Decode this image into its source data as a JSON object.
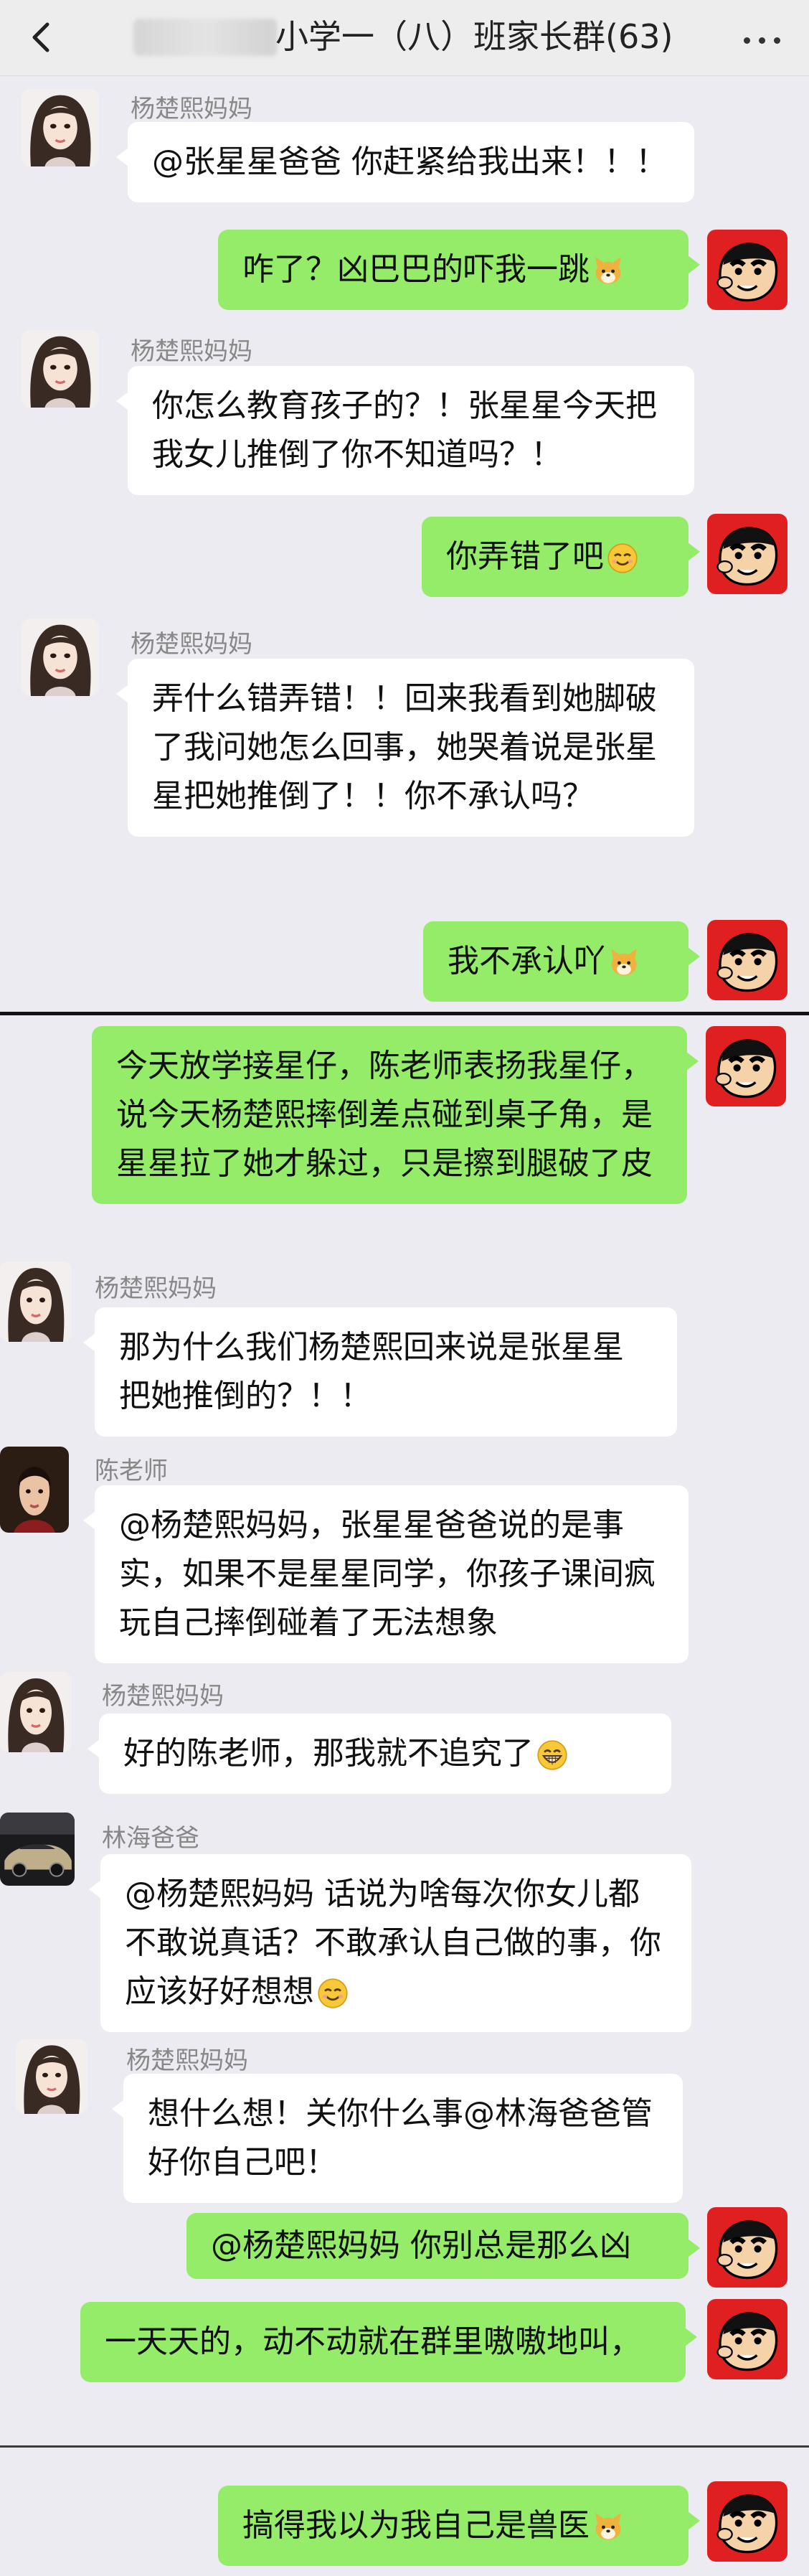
{
  "header": {
    "title": "小学一（八）班家长群(63)"
  },
  "messages": [
    {
      "sender": "杨楚熙妈妈",
      "text": "@张星星爸爸 你赶紧给我出来！！！"
    },
    {
      "sender": "me",
      "text": "咋了？凶巴巴的吓我一跳",
      "emoji": "dog-emoji"
    },
    {
      "sender": "杨楚熙妈妈",
      "text": "你怎么教育孩子的？！张星星今天把我女儿推倒了你不知道吗？！"
    },
    {
      "sender": "me",
      "text": "你弄错了吧",
      "emoji": "smile-emoji"
    },
    {
      "sender": "杨楚熙妈妈",
      "text": "弄什么错弄错！！回来我看到她脚破了我问她怎么回事，她哭着说是张星星把她推倒了！！你不承认吗？"
    },
    {
      "sender": "me",
      "text": "我不承认吖",
      "emoji": "dog-emoji"
    },
    {
      "sender": "me",
      "text": "今天放学接星仔，陈老师表扬我星仔，说今天杨楚熙摔倒差点碰到桌子角，是星星拉了她才躲过，只是擦到腿破了皮"
    },
    {
      "sender": "杨楚熙妈妈",
      "text": "那为什么我们杨楚熙回来说是张星星把她推倒的？！！"
    },
    {
      "sender": "陈老师",
      "text": "@杨楚熙妈妈，张星星爸爸说的是事实，如果不是星星同学，你孩子课间疯玩自己摔倒碰着了无法想象"
    },
    {
      "sender": "杨楚熙妈妈",
      "text": "好的陈老师，那我就不追究了",
      "emoji": "grin-emoji"
    },
    {
      "sender": "林海爸爸",
      "text": "@杨楚熙妈妈 话说为啥每次你女儿都不敢说真话？不敢承认自己做的事，你应该好好想想",
      "emoji": "smile-emoji"
    },
    {
      "sender": "杨楚熙妈妈",
      "text": "想什么想！关你什么事@林海爸爸管好你自己吧！"
    },
    {
      "sender": "me",
      "text": "@杨楚熙妈妈 你别总是那么凶"
    },
    {
      "sender": "me",
      "text": "一天天的，动不动就在群里嗷嗷地叫，"
    },
    {
      "sender": "me",
      "text": "搞得我以为我自己是兽医",
      "emoji": "dog-emoji"
    }
  ]
}
